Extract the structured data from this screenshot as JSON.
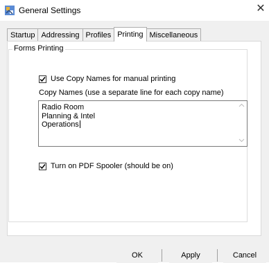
{
  "window": {
    "title": "General Settings",
    "close_glyph": "✕"
  },
  "tabs": [
    {
      "label": "Startup",
      "active": false
    },
    {
      "label": "Addressing",
      "active": false
    },
    {
      "label": "Profiles",
      "active": false
    },
    {
      "label": "Printing",
      "active": true
    },
    {
      "label": "Miscellaneous",
      "active": false
    }
  ],
  "forms_printing": {
    "group_label": "Forms Printing",
    "use_copy_names": {
      "label": "Use Copy Names for manual printing",
      "checked": true
    },
    "copy_names_label": "Copy Names (use a separate line for each copy name)",
    "copy_names_lines": [
      "Radio Room",
      "Planning & Intel",
      "Operations"
    ],
    "pdf_spooler": {
      "label": "Turn on PDF Spooler (should be on)",
      "checked": true
    }
  },
  "buttons": {
    "ok": "OK",
    "apply": "Apply",
    "cancel": "Cancel"
  },
  "icons": {
    "app": "app-icon",
    "close": "close-icon",
    "check": "checkmark-icon",
    "scroll_up": "scroll-up-icon",
    "scroll_down": "scroll-down-icon"
  }
}
